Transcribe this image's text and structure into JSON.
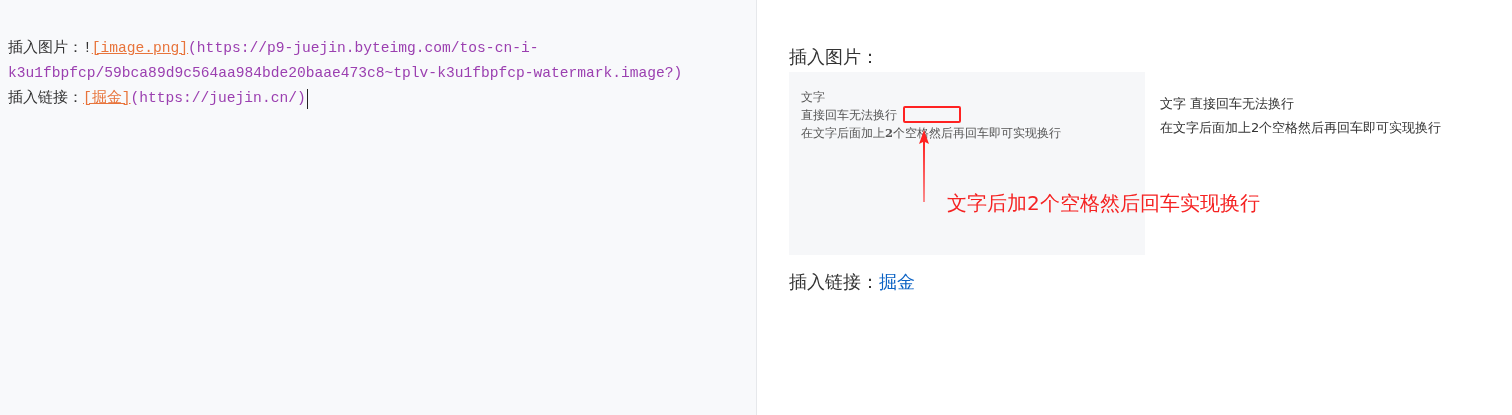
{
  "editor": {
    "lines": [
      {
        "parts": [
          {
            "kind": "text",
            "text": "插入图片："
          },
          {
            "kind": "syntax",
            "text": "!"
          },
          {
            "kind": "link_text",
            "text": "[image.png]"
          },
          {
            "kind": "url",
            "text": "(https://p9-juejin.byteimg.com/tos-cn-i-k3u1fbpfcp/59bca89d9c564aa984bde20baae473c8~tplv-k3u1fbpfcp-watermark.image?)"
          }
        ]
      },
      {
        "parts": [
          {
            "kind": "text",
            "text": "插入链接："
          },
          {
            "kind": "link_text",
            "text": "[掘金]"
          },
          {
            "kind": "url",
            "text": "(https://juejin.cn/)"
          }
        ],
        "cursor": true
      }
    ]
  },
  "preview": {
    "image_heading": "插入图片：",
    "image": {
      "lines": [
        "文字",
        "直接回车无法换行",
        "在文字后面加上**2**个空格然后再回车即可实现换行"
      ],
      "annotation": "文字后加2个空格然后回车实现换行",
      "result_lines": [
        "文字 直接回车无法换行",
        "在文字后面加上2个空格然后再回车即可实现换行"
      ]
    },
    "link_label": "插入链接：",
    "link": "掘金"
  }
}
